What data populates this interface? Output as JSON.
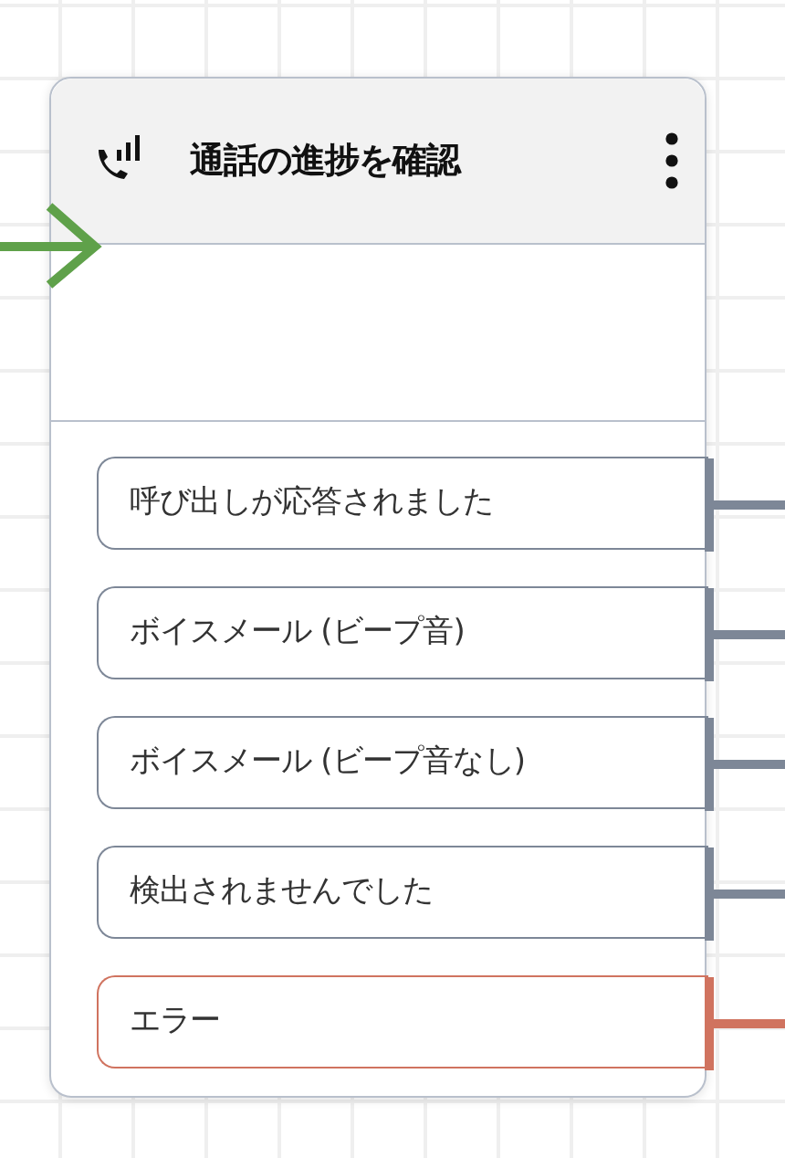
{
  "block": {
    "title": "通話の進捗を確認",
    "branches": [
      {
        "label": "呼び出しが応答されました",
        "kind": "normal"
      },
      {
        "label": "ボイスメール (ビープ音)",
        "kind": "normal"
      },
      {
        "label": "ボイスメール (ビープ音なし)",
        "kind": "normal"
      },
      {
        "label": "検出されませんでした",
        "kind": "normal"
      },
      {
        "label": "エラー",
        "kind": "error"
      }
    ]
  }
}
